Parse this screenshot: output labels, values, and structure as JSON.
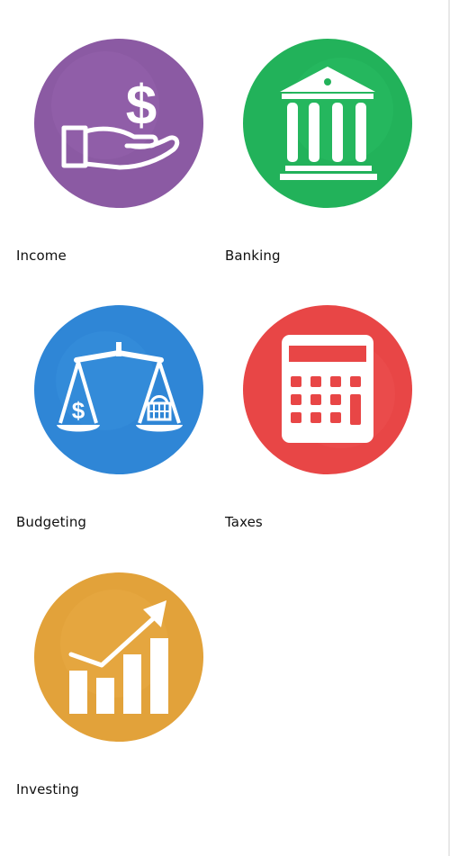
{
  "categories": [
    {
      "label": "Income",
      "color": "#8b5aa3",
      "icon": "hand-dollar-icon"
    },
    {
      "label": "Banking",
      "color": "#22b25a",
      "icon": "bank-icon"
    },
    {
      "label": "Budgeting",
      "color": "#2f86d6",
      "icon": "balance-scale-icon"
    },
    {
      "label": "Taxes",
      "color": "#e84646",
      "icon": "calculator-icon"
    },
    {
      "label": "Investing",
      "color": "#e2a23a",
      "icon": "growth-chart-icon"
    }
  ]
}
